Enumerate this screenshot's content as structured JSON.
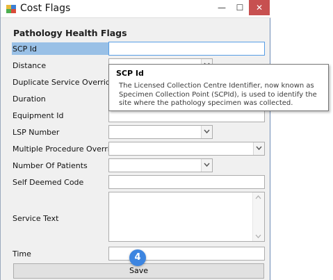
{
  "window": {
    "title": "Cost Flags",
    "minimize_glyph": "—",
    "maximize_glyph": "☐",
    "close_glyph": "✕"
  },
  "form": {
    "section_title": "Pathology Health Flags",
    "labels": {
      "scp_id": "SCP Id",
      "distance": "Distance",
      "duplicate_service_override": "Duplicate Service Override",
      "duration": "Duration",
      "equipment_id": "Equipment Id",
      "lsp_number": "LSP Number",
      "multiple_procedure_override": "Multiple Procedure Override",
      "number_of_patients": "Number Of Patients",
      "self_deemed_code": "Self Deemed Code",
      "service_text": "Service Text",
      "time": "Time"
    },
    "save_label": "Save"
  },
  "tooltip": {
    "title": "SCP Id",
    "body": "The Licensed Collection Centre Identifier, now known as Specimen Collection Point (SCPId), is used to identify the site where the pathology specimen was collected."
  },
  "step_badge": "4",
  "colors": {
    "focus_highlight": "#99c0e6",
    "badge": "#3d85e0",
    "close_button": "#c75050"
  }
}
